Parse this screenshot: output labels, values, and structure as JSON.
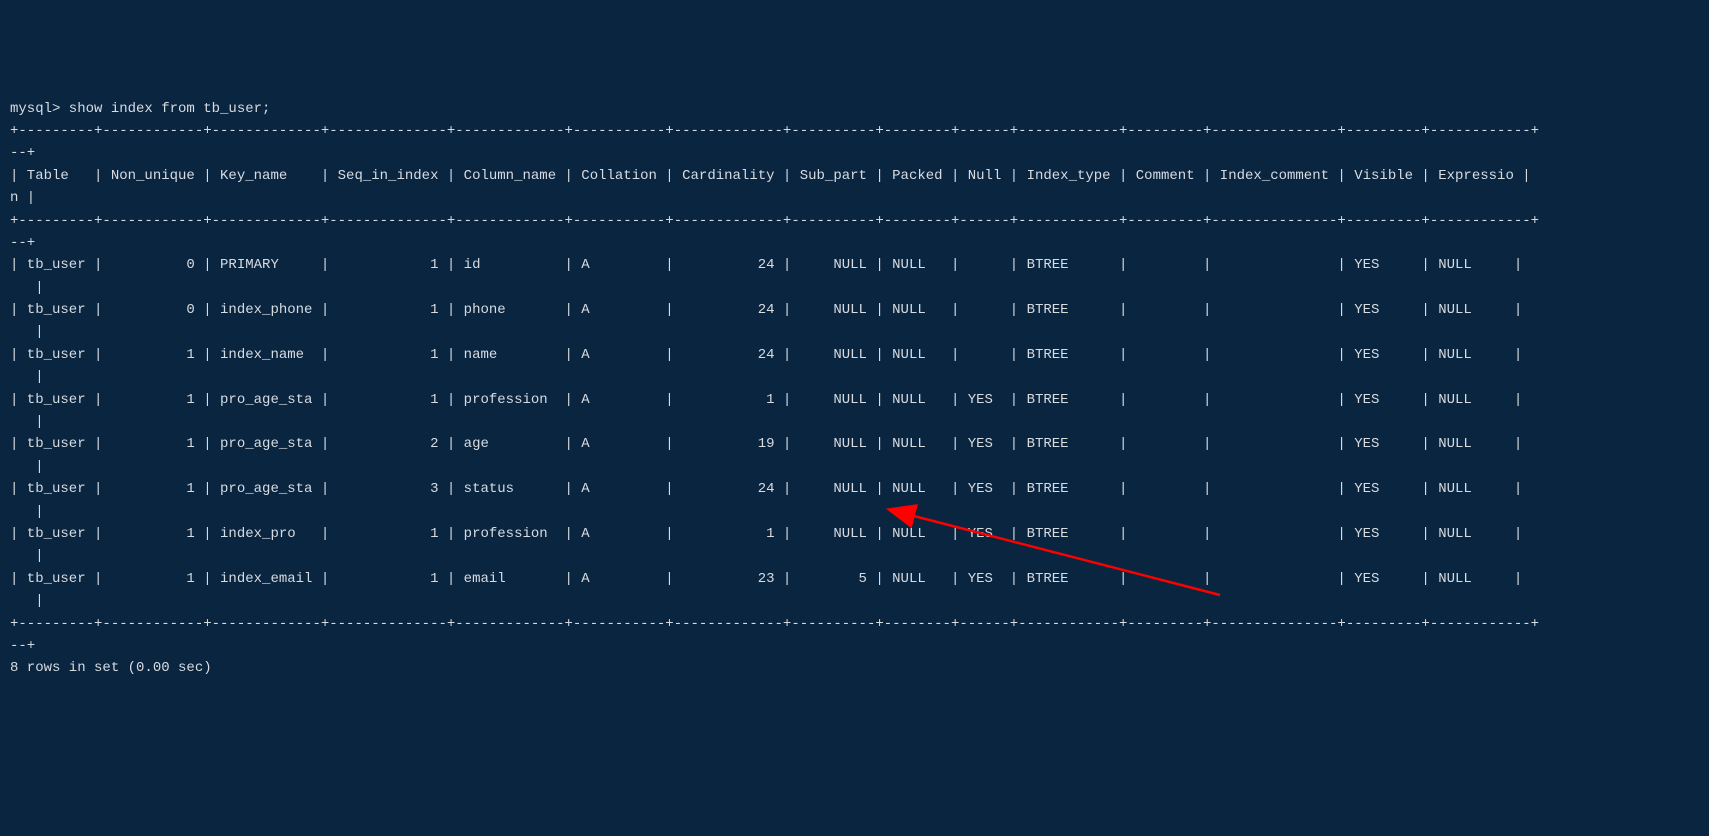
{
  "prompt": "mysql> show index from tb_user;",
  "separator_top": "+---------+------------+-------------+--------------+-------------+-----------+-------------+----------+--------+------+------------+---------+---------------+---------+------------+",
  "separator_bottom": "+---------+------------+-------------+--------------+-------------+-----------+-------------+----------+--------+------+------------+---------+---------------+---------+------------+",
  "header_wrap_suffix": "--+",
  "columns": [
    "Table",
    "Non_unique",
    "Key_name",
    "Seq_in_index",
    "Column_name",
    "Collation",
    "Cardinality",
    "Sub_part",
    "Packed",
    "Null",
    "Index_type",
    "Comment",
    "Index_comment",
    "Visible",
    "Expression"
  ],
  "last_col_wrap": "n |",
  "rows": [
    {
      "Table": "tb_user",
      "Non_unique": "0",
      "Key_name": "PRIMARY",
      "Seq_in_index": "1",
      "Column_name": "id",
      "Collation": "A",
      "Cardinality": "24",
      "Sub_part": "NULL",
      "Packed": "NULL",
      "Null": "",
      "Index_type": "BTREE",
      "Comment": "",
      "Index_comment": "",
      "Visible": "YES",
      "Expression": "NULL"
    },
    {
      "Table": "tb_user",
      "Non_unique": "0",
      "Key_name": "index_phone",
      "Seq_in_index": "1",
      "Column_name": "phone",
      "Collation": "A",
      "Cardinality": "24",
      "Sub_part": "NULL",
      "Packed": "NULL",
      "Null": "",
      "Index_type": "BTREE",
      "Comment": "",
      "Index_comment": "",
      "Visible": "YES",
      "Expression": "NULL"
    },
    {
      "Table": "tb_user",
      "Non_unique": "1",
      "Key_name": "index_name",
      "Seq_in_index": "1",
      "Column_name": "name",
      "Collation": "A",
      "Cardinality": "24",
      "Sub_part": "NULL",
      "Packed": "NULL",
      "Null": "",
      "Index_type": "BTREE",
      "Comment": "",
      "Index_comment": "",
      "Visible": "YES",
      "Expression": "NULL"
    },
    {
      "Table": "tb_user",
      "Non_unique": "1",
      "Key_name": "pro_age_sta",
      "Seq_in_index": "1",
      "Column_name": "profession",
      "Collation": "A",
      "Cardinality": "1",
      "Sub_part": "NULL",
      "Packed": "NULL",
      "Null": "YES",
      "Index_type": "BTREE",
      "Comment": "",
      "Index_comment": "",
      "Visible": "YES",
      "Expression": "NULL"
    },
    {
      "Table": "tb_user",
      "Non_unique": "1",
      "Key_name": "pro_age_sta",
      "Seq_in_index": "2",
      "Column_name": "age",
      "Collation": "A",
      "Cardinality": "19",
      "Sub_part": "NULL",
      "Packed": "NULL",
      "Null": "YES",
      "Index_type": "BTREE",
      "Comment": "",
      "Index_comment": "",
      "Visible": "YES",
      "Expression": "NULL"
    },
    {
      "Table": "tb_user",
      "Non_unique": "1",
      "Key_name": "pro_age_sta",
      "Seq_in_index": "3",
      "Column_name": "status",
      "Collation": "A",
      "Cardinality": "24",
      "Sub_part": "NULL",
      "Packed": "NULL",
      "Null": "YES",
      "Index_type": "BTREE",
      "Comment": "",
      "Index_comment": "",
      "Visible": "YES",
      "Expression": "NULL"
    },
    {
      "Table": "tb_user",
      "Non_unique": "1",
      "Key_name": "index_pro",
      "Seq_in_index": "1",
      "Column_name": "profession",
      "Collation": "A",
      "Cardinality": "1",
      "Sub_part": "NULL",
      "Packed": "NULL",
      "Null": "YES",
      "Index_type": "BTREE",
      "Comment": "",
      "Index_comment": "",
      "Visible": "YES",
      "Expression": "NULL"
    },
    {
      "Table": "tb_user",
      "Non_unique": "1",
      "Key_name": "index_email",
      "Seq_in_index": "1",
      "Column_name": "email",
      "Collation": "A",
      "Cardinality": "23",
      "Sub_part": "5",
      "Packed": "NULL",
      "Null": "YES",
      "Index_type": "BTREE",
      "Comment": "",
      "Index_comment": "",
      "Visible": "YES",
      "Expression": "NULL"
    }
  ],
  "footer": "8 rows in set (0.00 sec)",
  "widths": {
    "Table": 7,
    "Non_unique": 10,
    "Key_name": 11,
    "Seq_in_index": 12,
    "Column_name": 11,
    "Collation": 9,
    "Cardinality": 11,
    "Sub_part": 8,
    "Packed": 6,
    "Null": 4,
    "Index_type": 10,
    "Comment": 7,
    "Index_comment": 13,
    "Visible": 7,
    "Expression": 8
  },
  "right_align": [
    "Non_unique",
    "Seq_in_index",
    "Cardinality",
    "Sub_part"
  ]
}
